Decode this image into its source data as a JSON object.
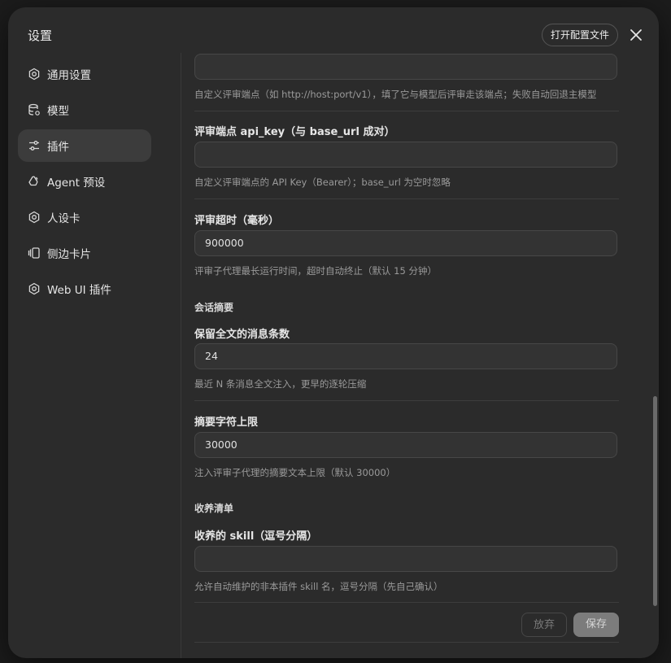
{
  "dialog": {
    "title": "设置",
    "open_config_label": "打开配置文件"
  },
  "sidebar": {
    "items": [
      {
        "label": "通用设置",
        "icon": "gear-icon"
      },
      {
        "label": "模型",
        "icon": "database-icon"
      },
      {
        "label": "插件",
        "icon": "sliders-icon"
      },
      {
        "label": "Agent 预设",
        "icon": "recycle-icon"
      },
      {
        "label": "人设卡",
        "icon": "gear-icon"
      },
      {
        "label": "侧边卡片",
        "icon": "cards-icon"
      },
      {
        "label": "Web UI 插件",
        "icon": "gear-icon"
      }
    ],
    "active_index": 2
  },
  "fields": {
    "review_base_url": {
      "value": "",
      "help": "自定义评审端点（如 http://host:port/v1），填了它与模型后评审走该端点；失败自动回退主模型"
    },
    "review_api_key": {
      "label": "评审端点 api_key（与 base_url 成对）",
      "value": "",
      "help": "自定义评审端点的 API Key（Bearer）；base_url 为空时忽略"
    },
    "review_timeout": {
      "label": "评审超时（毫秒）",
      "value": "900000",
      "help": "评审子代理最长运行时间，超时自动终止（默认 15 分钟）"
    },
    "summary_section": "会话摘要",
    "keep_full_messages": {
      "label": "保留全文的消息条数",
      "value": "24",
      "help": "最近 N 条消息全文注入，更早的逐轮压缩"
    },
    "summary_char_limit": {
      "label": "摘要字符上限",
      "value": "30000",
      "help": "注入评审子代理的摘要文本上限（默认 30000）"
    },
    "adopt_section": "收养清单",
    "adopted_skills": {
      "label": "收养的 skill（逗号分隔）",
      "value": "",
      "help": "允许自动维护的非本插件 skill 名，逗号分隔（先自己确认）"
    }
  },
  "actions": {
    "discard_label": "放弃",
    "save_label": "保存"
  }
}
